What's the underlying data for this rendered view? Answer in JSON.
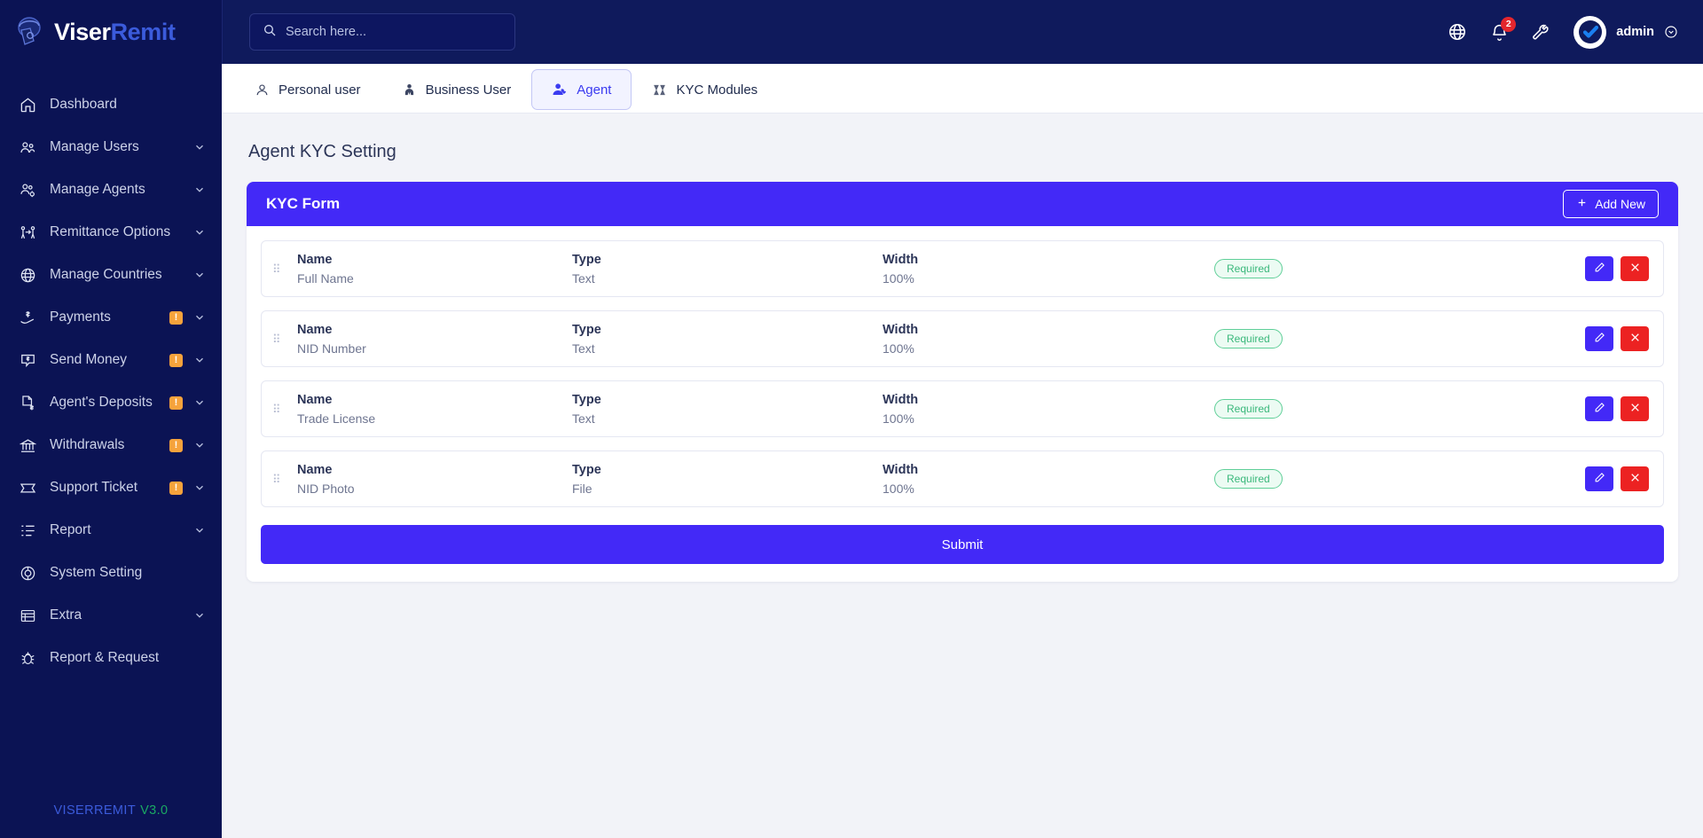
{
  "brand": {
    "name_white": "Viser",
    "name_blue": "Remit"
  },
  "sidebar": {
    "items": [
      {
        "label": "Dashboard",
        "icon": "home-icon",
        "badge": "",
        "chevron": false
      },
      {
        "label": "Manage Users",
        "icon": "users-icon",
        "badge": "",
        "chevron": true
      },
      {
        "label": "Manage Agents",
        "icon": "agents-icon",
        "badge": "",
        "chevron": true
      },
      {
        "label": "Remittance Options",
        "icon": "remittance-icon",
        "badge": "",
        "chevron": true
      },
      {
        "label": "Manage Countries",
        "icon": "globe-icon",
        "badge": "",
        "chevron": true
      },
      {
        "label": "Payments",
        "icon": "payments-icon",
        "badge": "!",
        "chevron": true
      },
      {
        "label": "Send Money",
        "icon": "send-money-icon",
        "badge": "!",
        "chevron": true
      },
      {
        "label": "Agent's Deposits",
        "icon": "deposits-icon",
        "badge": "!",
        "chevron": true
      },
      {
        "label": "Withdrawals",
        "icon": "bank-icon",
        "badge": "!",
        "chevron": true
      },
      {
        "label": "Support Ticket",
        "icon": "ticket-icon",
        "badge": "!",
        "chevron": true
      },
      {
        "label": "Report",
        "icon": "report-icon",
        "badge": "",
        "chevron": true
      },
      {
        "label": "System Setting",
        "icon": "settings-icon",
        "badge": "",
        "chevron": false
      },
      {
        "label": "Extra",
        "icon": "extra-icon",
        "badge": "",
        "chevron": true
      },
      {
        "label": "Report & Request",
        "icon": "bug-icon",
        "badge": "",
        "chevron": false
      }
    ],
    "footer": {
      "name": "VISERREMIT",
      "version": "V3.0"
    }
  },
  "topbar": {
    "search_placeholder": "Search here...",
    "search_value": "",
    "notification_count": "2",
    "user_name": "admin",
    "icons": [
      "globe-icon",
      "bell-icon",
      "wrench-icon",
      "chevron-down-icon"
    ]
  },
  "tabs": [
    {
      "label": "Personal user",
      "icon": "person-icon",
      "active": false
    },
    {
      "label": "Business User",
      "icon": "business-icon",
      "active": false
    },
    {
      "label": "Agent",
      "icon": "agent-icon",
      "active": true
    },
    {
      "label": "KYC Modules",
      "icon": "modules-icon",
      "active": false
    }
  ],
  "page": {
    "title": "Agent KYC Setting"
  },
  "card": {
    "title": "KYC Form",
    "add_new_label": "Add New",
    "add_new_icon": "plus-icon",
    "submit_label": "Submit",
    "column_labels": {
      "name": "Name",
      "type": "Type",
      "width": "Width"
    },
    "rows": [
      {
        "name": "Full Name",
        "type": "Text",
        "width": "100%",
        "badge": "Required"
      },
      {
        "name": "NID Number",
        "type": "Text",
        "width": "100%",
        "badge": "Required"
      },
      {
        "name": "Trade License",
        "type": "Text",
        "width": "100%",
        "badge": "Required"
      },
      {
        "name": "NID Photo",
        "type": "File",
        "width": "100%",
        "badge": "Required"
      }
    ]
  },
  "colors": {
    "sidebar_bg": "#0b1354",
    "topbar_bg": "#0f1a5c",
    "accent": "#4329f7",
    "danger": "#ec2222",
    "badge_green": "#3ab87b",
    "badge_orange": "#f6a33c"
  }
}
